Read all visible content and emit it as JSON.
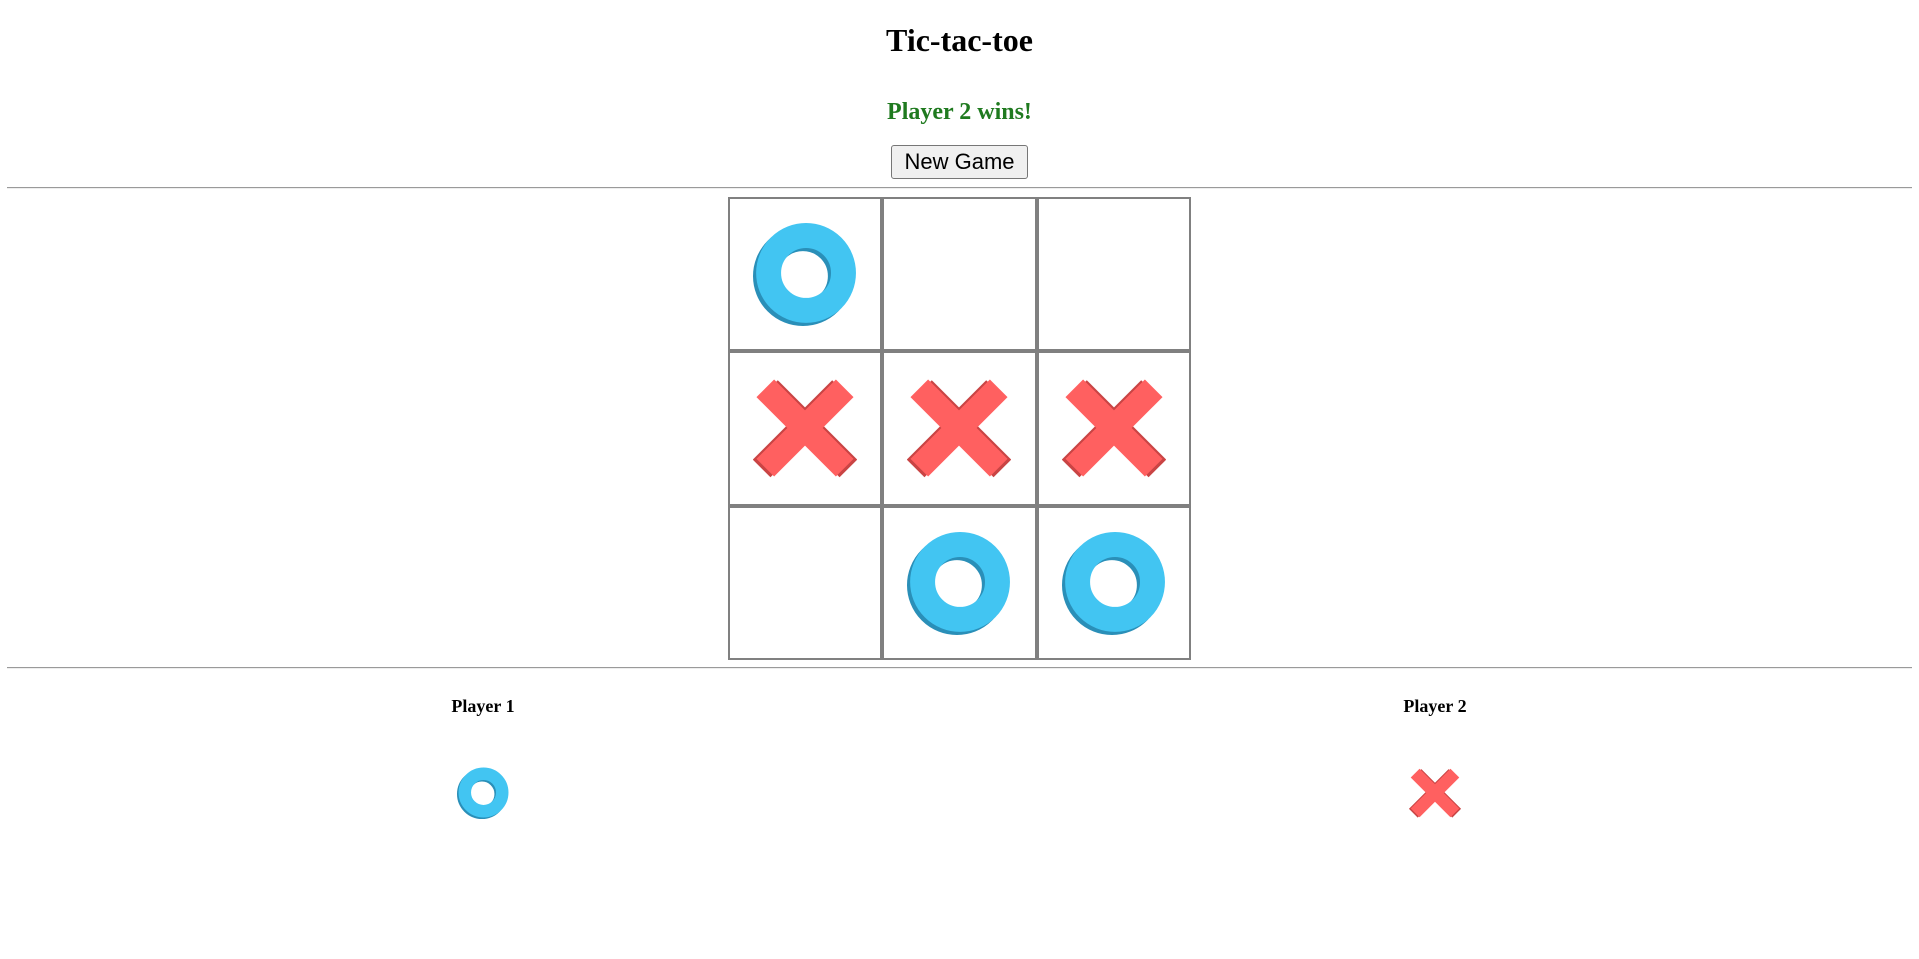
{
  "page": {
    "title": "Tic-tac-toe",
    "status": "Player 2 wins!",
    "new_game_label": "New Game"
  },
  "colors": {
    "status": "#1f7a1f",
    "o_mark": "#42c5f2",
    "o_shadow": "#2a8fb8",
    "x_mark": "#ff6060",
    "x_shadow": "#c94444",
    "grid": "#808080"
  },
  "board": {
    "cells": [
      "O",
      "",
      "",
      "X",
      "X",
      "X",
      "",
      "O",
      "O"
    ]
  },
  "players": [
    {
      "label": "Player 1",
      "mark": "O",
      "icon": "o-mark-icon"
    },
    {
      "label": "Player 2",
      "mark": "X",
      "icon": "x-mark-icon"
    }
  ]
}
